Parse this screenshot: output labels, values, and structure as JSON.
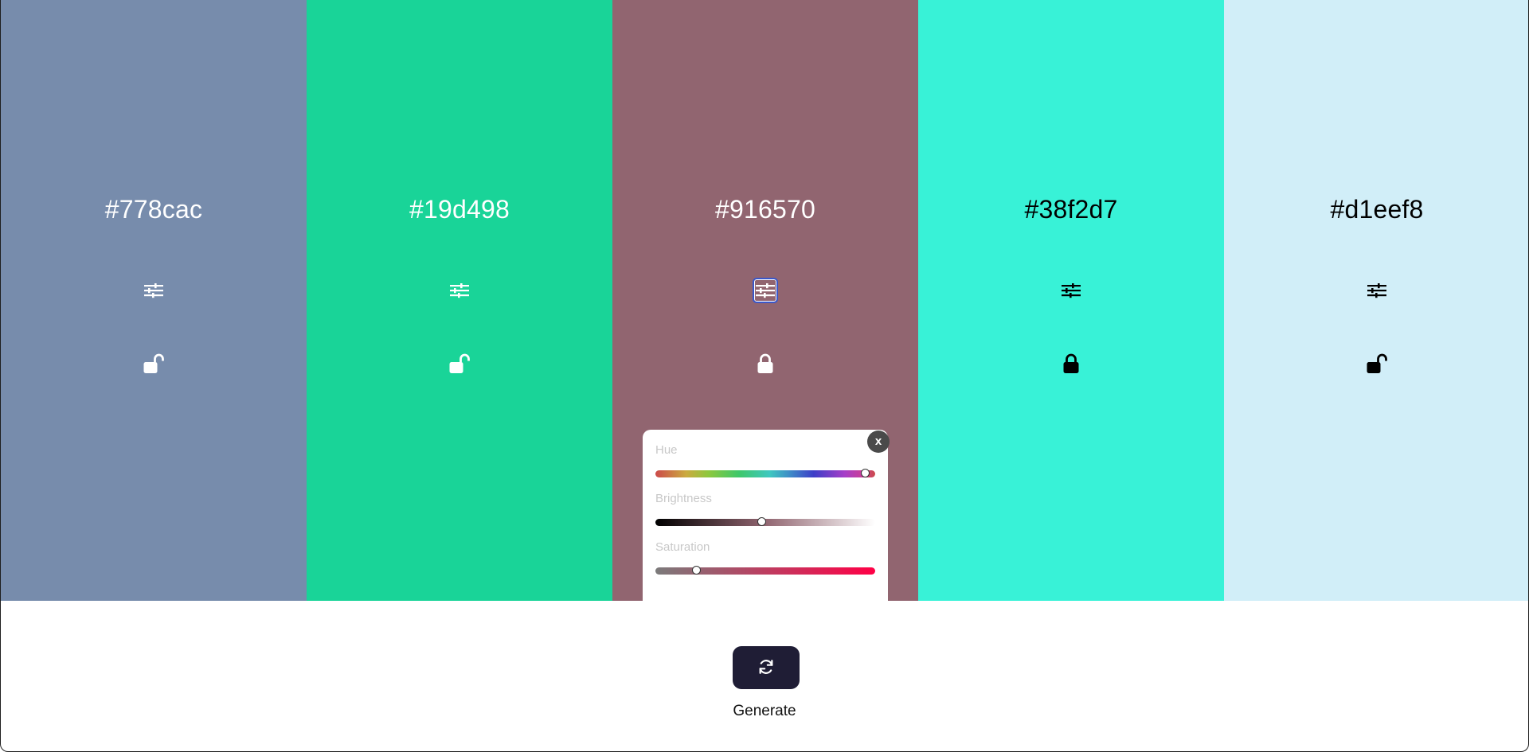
{
  "palette": {
    "colors": [
      {
        "hex": "#778cac",
        "text_color": "#ffffff",
        "locked": false
      },
      {
        "hex": "#19d498",
        "text_color": "#ffffff",
        "locked": false
      },
      {
        "hex": "#916570",
        "text_color": "#ffffff",
        "locked": true,
        "adjust_active": true
      },
      {
        "hex": "#38f2d7",
        "text_color": "#000000",
        "locked": true
      },
      {
        "hex": "#d1eef8",
        "text_color": "#000000",
        "locked": false
      }
    ]
  },
  "adjust_panel": {
    "close_label": "x",
    "sliders": [
      {
        "label": "Hue",
        "value_fraction": 0.955
      },
      {
        "label": "Brightness",
        "value_fraction": 0.485
      },
      {
        "label": "Saturation",
        "value_fraction": 0.19
      }
    ]
  },
  "footer": {
    "generate_label": "Generate",
    "generate_icon": "refresh-icon",
    "generate_button_color": "#1f1d35"
  },
  "icons": {
    "adjust": "sliders-icon",
    "lock_open": "unlock-icon",
    "lock_closed": "lock-icon"
  }
}
